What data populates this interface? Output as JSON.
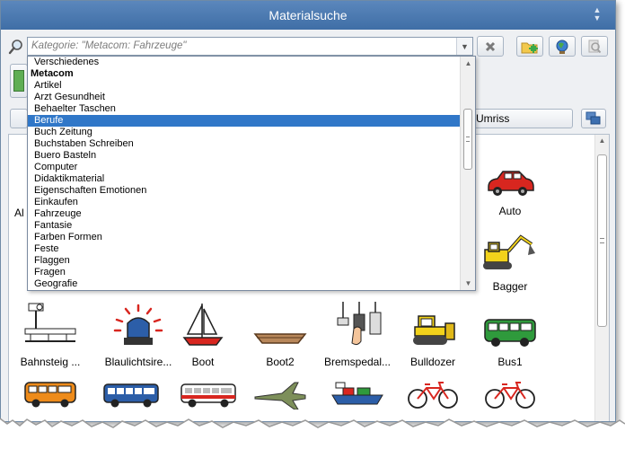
{
  "window": {
    "title": "Materialsuche"
  },
  "search": {
    "placeholder": "Kategorie: \"Metacom: Fahrzeuge\""
  },
  "toolbar": {
    "umriss_label": "Umriss"
  },
  "dropdown": {
    "items": [
      {
        "label": "Verschiedenes",
        "type": "item"
      },
      {
        "label": "Metacom",
        "type": "group"
      },
      {
        "label": "Artikel",
        "type": "item"
      },
      {
        "label": "Arzt Gesundheit",
        "type": "item"
      },
      {
        "label": "Behaelter Taschen",
        "type": "item"
      },
      {
        "label": "Berufe",
        "type": "item",
        "selected": true
      },
      {
        "label": "Buch Zeitung",
        "type": "item"
      },
      {
        "label": "Buchstaben Schreiben",
        "type": "item"
      },
      {
        "label": "Buero Basteln",
        "type": "item"
      },
      {
        "label": "Computer",
        "type": "item"
      },
      {
        "label": "Didaktikmaterial",
        "type": "item"
      },
      {
        "label": "Eigenschaften Emotionen",
        "type": "item"
      },
      {
        "label": "Einkaufen",
        "type": "item"
      },
      {
        "label": "Fahrzeuge",
        "type": "item"
      },
      {
        "label": "Fantasie",
        "type": "item"
      },
      {
        "label": "Farben Formen",
        "type": "item"
      },
      {
        "label": "Feste",
        "type": "item"
      },
      {
        "label": "Flaggen",
        "type": "item"
      },
      {
        "label": "Fragen",
        "type": "item"
      },
      {
        "label": "Geografie",
        "type": "item"
      }
    ]
  },
  "tiles": {
    "partial_a": "Al",
    "auto": "Auto",
    "bagger": "Bagger",
    "bahnsteig": "Bahnsteig ...",
    "blaulicht": "Blaulichtsire...",
    "boot": "Boot",
    "boot2": "Boot2",
    "bremspedal": "Bremspedal...",
    "bulldozer": "Bulldozer",
    "bus1": "Bus1"
  },
  "colors": {
    "title_bar": "#4a78b0",
    "selection": "#3077c8",
    "car_red": "#d8261f",
    "bus_green": "#2f9a3c",
    "bus_orange": "#ee8b1a",
    "bus_blue": "#2c5ea8",
    "excavator_yellow": "#f2d21b"
  }
}
